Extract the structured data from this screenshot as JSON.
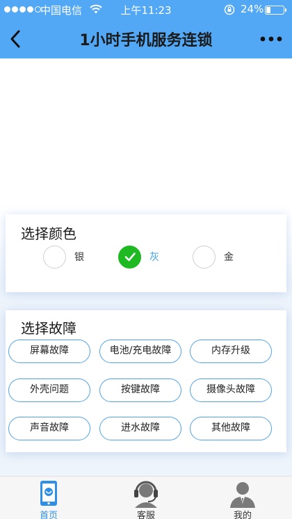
{
  "status_bar": {
    "carrier": "中国电信",
    "time": "上午11:23",
    "battery": "24%",
    "battery_level": 0.24,
    "signal_bars": 4
  },
  "header": {
    "title": "1小时手机服务连锁",
    "back_icon": "chevron-left-icon",
    "more_icon": "more-dots-icon"
  },
  "color_section": {
    "title": "选择颜色",
    "options": [
      {
        "label": "银",
        "selected": false
      },
      {
        "label": "灰",
        "selected": true
      },
      {
        "label": "金",
        "selected": false
      }
    ]
  },
  "fault_section": {
    "title": "选择故障",
    "options": [
      "屏幕故障",
      "电池/充电故障",
      "内存升级",
      "外壳问题",
      "按键故障",
      "摄像头故障",
      "声音故障",
      "进水故障",
      "其他故障"
    ]
  },
  "tabbar": {
    "items": [
      {
        "label": "首页",
        "icon": "home-phone-icon",
        "active": true
      },
      {
        "label": "客服",
        "icon": "headset-agent-icon",
        "active": false
      },
      {
        "label": "我的",
        "icon": "user-profile-icon",
        "active": false
      }
    ]
  },
  "colors": {
    "header_bg": "#52a8f5",
    "accent": "#4fa2ea",
    "selected_green": "#1fb923"
  }
}
